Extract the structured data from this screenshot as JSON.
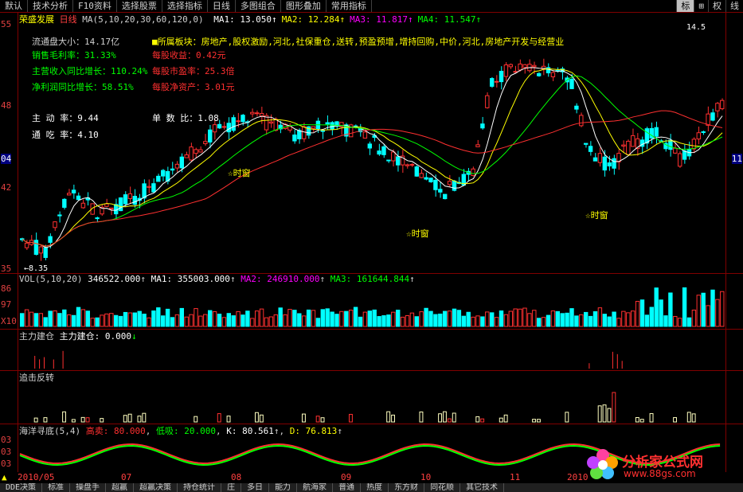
{
  "toolbar": {
    "left_items": [
      "默认",
      "技术分析",
      "F10资料",
      "选择股票",
      "选择指标",
      "日线",
      "多图组合",
      "图形叠加",
      "常用指标"
    ],
    "right_items": [
      "标",
      "⊞",
      "权",
      "线"
    ]
  },
  "main": {
    "stock": "荣盛发展",
    "period": "日线",
    "ma_header": "MA(5,10,20,30,60,120,0)",
    "ma_values": [
      {
        "label": "MA1: 13.050",
        "arrow": "↑",
        "color": "#ffffff"
      },
      {
        "label": "MA2: 12.284",
        "arrow": "↑",
        "color": "#ffff00"
      },
      {
        "label": "MA3: 11.817",
        "arrow": "↑",
        "color": "#ff00ff"
      },
      {
        "label": "MA4: 11.547",
        "arrow": "↑",
        "color": "#00ff00"
      }
    ],
    "y_ticks_left": [
      "55",
      "48",
      "04",
      "42",
      "35"
    ],
    "y_ticks_right": [
      "11"
    ],
    "info": {
      "float_cap": "流通盘大小：14.17亿",
      "gross_margin": "销售毛利率：31.33%",
      "rev_growth": "主营收入同比增长：110.24%",
      "profit_growth": "净利润同比增长：58.51%",
      "sector": "■所属板块：房地产,股权激励,河北,社保重仓,送转,预盈预增,增持回购,中价,河北,房地产开发与经营业",
      "eps": "每股收益：0.42元",
      "pe": "每股市盈率：25.3倍",
      "nav": "每股净资产：3.01元",
      "active_rate": "主 动 率：9.44",
      "single_ratio": "单 数 比：1.08",
      "absorb_rate": "通 吃 率：4.10"
    },
    "markers": [
      "☆时窗",
      "☆时窗",
      "☆时窗"
    ],
    "low_label": "←8.35",
    "high_label": "14.5",
    "price_min": 8.35,
    "price_max": 14.5
  },
  "vol": {
    "header": "VOL(5,10,20)",
    "value": "346522.000",
    "ma1": "MA1: 355003.000",
    "ma2": "MA2: 246910.000",
    "ma3": "MA3: 161644.844",
    "y_ticks": [
      "86",
      "97",
      "X10"
    ]
  },
  "ind1": {
    "title": "主力建仓",
    "value": "主力建仓: 0.000",
    "arrow": "↓"
  },
  "ind2": {
    "title": "追击反转"
  },
  "ind3": {
    "title": "海洋寻底(5,4)",
    "high": "高卖: 80.000",
    "low": "低吸: 20.000",
    "k": "K: 80.561",
    "d": "D: 76.813",
    "y_ticks": [
      "03",
      "03",
      "03"
    ]
  },
  "dates": [
    "2010/05",
    "07",
    "08",
    "09",
    "10",
    "11",
    "2010"
  ],
  "bottom_tabs": [
    "DDE决策",
    "标准",
    "操盘手",
    "超赢",
    "超赢决策",
    "持仓统计",
    "庄",
    "多日",
    "能力",
    "航海家",
    "普通",
    "热度",
    "东方财",
    "同花顺",
    "其它技术"
  ],
  "colors": {
    "up": "#ff3030",
    "down": "#00ffff",
    "grid": "#800000"
  },
  "watermark": {
    "title": "分析家公式网",
    "url": "www.88gs.com"
  }
}
